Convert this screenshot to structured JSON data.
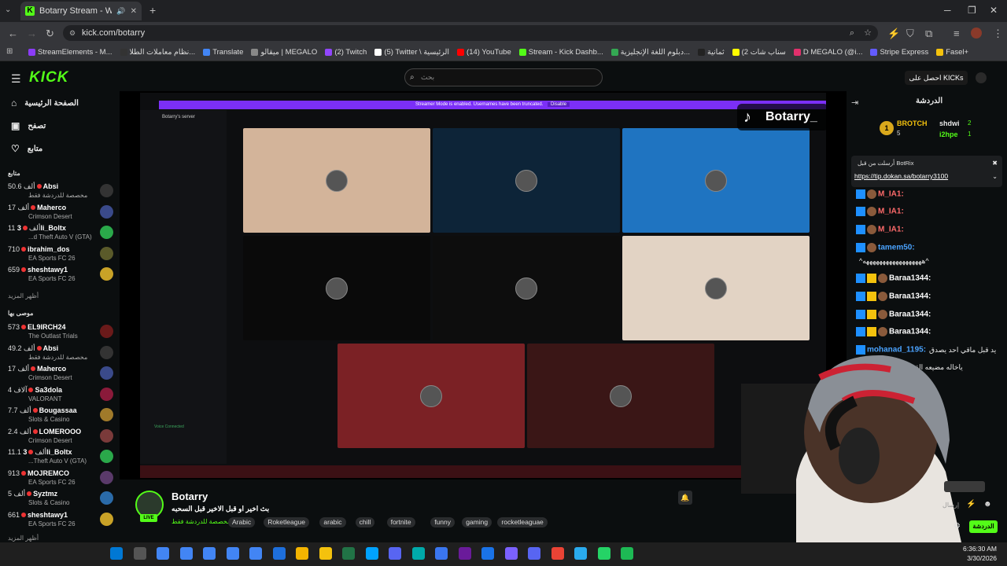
{
  "browser": {
    "tab_title": "Botarry Stream - Watch Live",
    "url": "kick.com/botarry",
    "bookmarks": [
      "StreamElements - M...",
      "نظام معاملات الطلا...",
      "Translate",
      "ميقالو | MEGALO",
      "(2) Twitch",
      "(5) Twitter \\ الرئيسية",
      "(14) YouTube",
      "Stream - Kick Dashb...",
      "دبلوم اللغة الإنجليزية...",
      "ثمانية",
      "(2 سناب شات",
      "D MEGALO (@i...",
      "Stripe Express",
      "Fasel+"
    ]
  },
  "header": {
    "logo": "KICK",
    "search_placeholder": "بحث",
    "get_kicks": "احصل على KICKs"
  },
  "sidebar": {
    "nav": [
      {
        "label": "الصفحة الرئيسية",
        "icon": "home-icon"
      },
      {
        "label": "تصفح",
        "icon": "browse-icon"
      },
      {
        "label": "متابع",
        "icon": "heart-icon"
      }
    ],
    "following_title": "متابع",
    "following": [
      {
        "count": "50.6 ألف",
        "name": "Absi",
        "category": "مخصصة للدردشة فقط",
        "color": "#333"
      },
      {
        "count": "17 ألف",
        "name": "Maherco",
        "category": "Crimson Desert",
        "color": "#3a4a8a"
      },
      {
        "count": "11 ألف",
        "name": "3li_Boltx",
        "category": "...d Theft Auto V (GTA)",
        "color": "#2aa84a"
      },
      {
        "count": "710",
        "name": "ibrahim_dos",
        "category": "EA Sports FC 26",
        "color": "#5a5a2a"
      },
      {
        "count": "659",
        "name": "sheshtawy1",
        "category": "EA Sports FC 26",
        "color": "#c9a227"
      }
    ],
    "show_more": "أظهر المزيد",
    "recommended_title": "موصى بها",
    "recommended": [
      {
        "count": "573",
        "name": "EL9IRCH24",
        "category": "The Outlast Trials",
        "color": "#6a1a1a"
      },
      {
        "count": "49.2 ألف",
        "name": "Absi",
        "category": "مخصصة للدردشة فقط",
        "color": "#333"
      },
      {
        "count": "17 ألف",
        "name": "Maherco",
        "category": "Crimson Desert",
        "color": "#3a4a8a"
      },
      {
        "count": "4 آلاف",
        "name": "Sa3dola",
        "category": "VALORANT",
        "color": "#8a1a3a"
      },
      {
        "count": "7.7 ألف",
        "name": "Bougassaa",
        "category": "Slots & Casino",
        "color": "#a07a2a"
      },
      {
        "count": "2.4 ألف",
        "name": "LOMEROOO",
        "category": "Crimson Desert",
        "color": "#7a3a3a"
      },
      {
        "count": "11.1 ألف",
        "name": "3li_Boltx",
        "category": "...Theft Auto V (GTA)",
        "color": "#2aa84a"
      },
      {
        "count": "913",
        "name": "MOJREMCO",
        "category": "EA Sports FC 26",
        "color": "#5a3a6a"
      },
      {
        "count": "5 ألف",
        "name": "Syztmz",
        "category": "Slots & Casino",
        "color": "#2a6aa8"
      },
      {
        "count": "661",
        "name": "sheshtawy1",
        "category": "EA Sports FC 26",
        "color": "#c9a227"
      }
    ],
    "show_more_2": "أظهر المزيد"
  },
  "player": {
    "banner": "Streamer Mode is enabled. Usernames have been truncated.",
    "banner_btn": "Disable",
    "discord_server": "Botarry's server",
    "voice_connected": "Voice Connected",
    "tiktok_name": "Botarry_",
    "tiles": [
      "#d3b49a",
      "#0d2438",
      "#1f74c1",
      "#0a0a0a",
      "#0d0d0d",
      "#e2d3c4",
      "#7b2125",
      "#3a1616"
    ]
  },
  "stream": {
    "name": "Botarry",
    "live": "LIVE",
    "title": "بث اخير او قبل الاخير قبل السحبه",
    "category": "مخصصة للدردشة فقط",
    "tags": [
      "Arabic",
      "Roketleague",
      "arabic",
      "chill",
      "fortnite",
      "funny",
      "gaming",
      "rocketleaguae"
    ]
  },
  "chat": {
    "title": "الدردشة",
    "top": [
      {
        "rank": "1",
        "name": "BROTCH",
        "score": "5"
      },
      {
        "name": "shdwi",
        "score": "2"
      },
      {
        "name": "i2hpe",
        "score": "1"
      }
    ],
    "pinned_by": "أرسلت من قبل BotRix",
    "pinned_link": "https://tip.dokan.sa/botarry3100",
    "messages": [
      {
        "user": "M_IA1:",
        "text": "",
        "color": "#ff6b6b"
      },
      {
        "user": "M_IA1:",
        "text": "",
        "color": "#ff6b6b"
      },
      {
        "user": "M_IA1:",
        "text": "",
        "color": "#ff6b6b"
      },
      {
        "user": "tamem50:",
        "text": "",
        "color": "#4aa3ff"
      },
      {
        "user": "",
        "text": "^ههههههههههههههههههه^",
        "color": "#fff"
      },
      {
        "user": "Baraa1344:",
        "text": "",
        "color": "#fff"
      },
      {
        "user": "Baraa1344:",
        "text": "",
        "color": "#fff"
      },
      {
        "user": "Baraa1344:",
        "text": "",
        "color": "#fff"
      },
      {
        "user": "Baraa1344:",
        "text": "",
        "color": "#fff"
      },
      {
        "user": "mohanad_1195:",
        "text": "يد قبل ماقي احد يصدق",
        "color": "#4aa3ff"
      },
      {
        "user": "M_IA1:",
        "text": "ياخاله مضيعه القبله",
        "color": "#ff6b6b"
      }
    ],
    "send_placeholder": "إرسال",
    "chat_button": "الدردشة"
  },
  "taskbar": {
    "time": "6:36:30 AM",
    "date": "3/30/2026"
  }
}
